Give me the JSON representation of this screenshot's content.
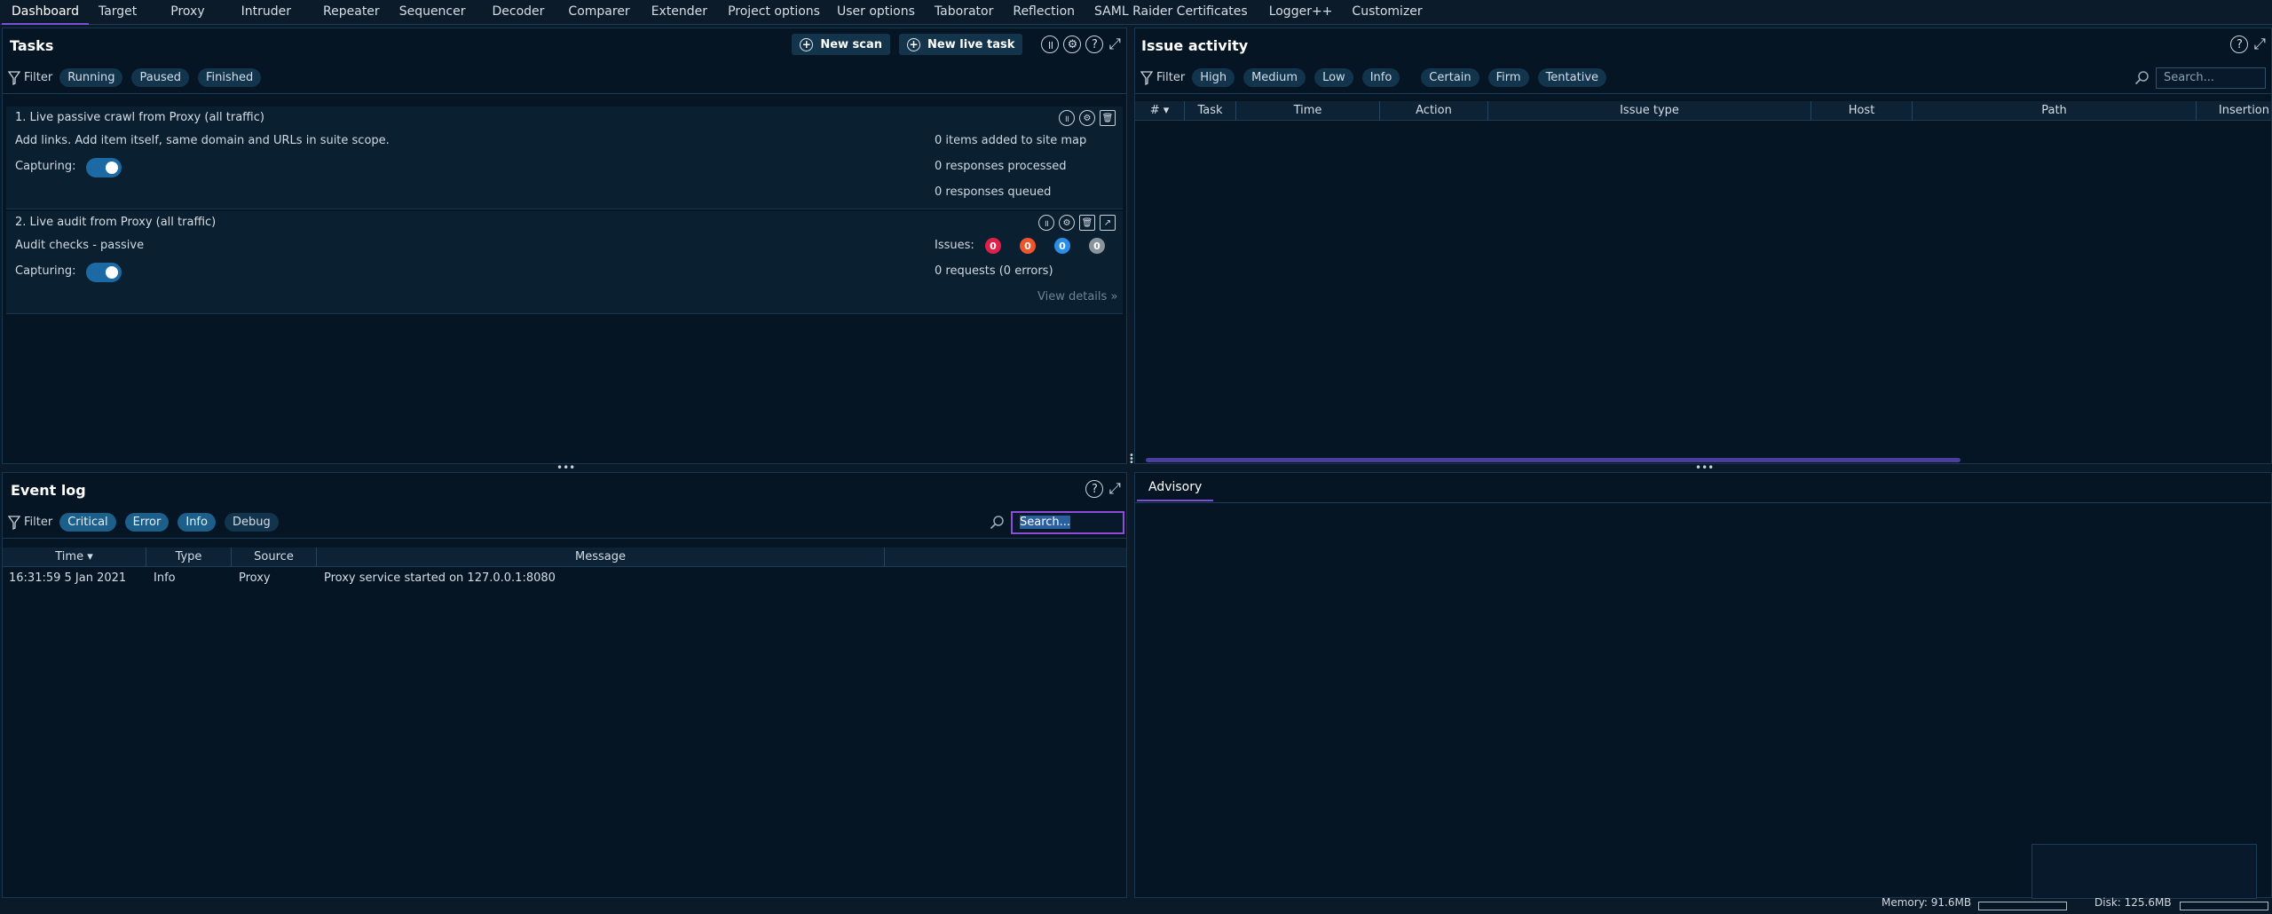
{
  "nav": {
    "tabs": [
      "Dashboard",
      "Target",
      "Proxy",
      "Intruder",
      "Repeater",
      "Sequencer",
      "Decoder",
      "Comparer",
      "Extender",
      "Project options",
      "User options",
      "Taborator",
      "Reflection",
      "SAML Raider Certificates",
      "Logger++",
      "Customizer"
    ],
    "active": "Dashboard"
  },
  "tasks": {
    "title": "Tasks",
    "new_scan": "New scan",
    "new_live_task": "New live task",
    "filter_label": "Filter",
    "filters": [
      "Running",
      "Paused",
      "Finished"
    ],
    "items": [
      {
        "title": "1. Live passive crawl from Proxy (all traffic)",
        "description": "Add links. Add item itself, same domain and URLs in suite scope.",
        "capturing_label": "Capturing:",
        "stats": [
          "0 items added to site map",
          "0 responses processed",
          "0 responses queued"
        ]
      },
      {
        "title": "2. Live audit from Proxy (all traffic)",
        "description": "Audit checks - passive",
        "capturing_label": "Capturing:",
        "issues_label": "Issues:",
        "issue_counts": [
          "0",
          "0",
          "0",
          "0"
        ],
        "requests": "0 requests (0 errors)",
        "view_details": "View details"
      }
    ]
  },
  "issue_activity": {
    "title": "Issue activity",
    "filter_label": "Filter",
    "severity_filters": [
      "High",
      "Medium",
      "Low",
      "Info"
    ],
    "confidence_filters": [
      "Certain",
      "Firm",
      "Tentative"
    ],
    "search_placeholder": "Search...",
    "columns": [
      "#",
      "Task",
      "Time",
      "Action",
      "Issue type",
      "Host",
      "Path",
      "Insertion"
    ]
  },
  "event_log": {
    "title": "Event log",
    "filter_label": "Filter",
    "filters": [
      "Critical",
      "Error",
      "Info",
      "Debug"
    ],
    "search_value": "Search...",
    "columns": [
      "Time",
      "Type",
      "Source",
      "Message"
    ],
    "rows": [
      {
        "time": "16:31:59 5 Jan 2021",
        "type": "Info",
        "source": "Proxy",
        "message": "Proxy service started on 127.0.0.1:8080"
      }
    ]
  },
  "advisory": {
    "tab": "Advisory"
  },
  "status": {
    "memory": "Memory: 91.6MB",
    "disk": "Disk: 125.6MB"
  },
  "colors": {
    "background": "#051524",
    "accent": "#7b4fd8",
    "high": "#e0204a",
    "medium": "#f0542a",
    "low": "#2a8ee8",
    "info": "#8a949c"
  }
}
